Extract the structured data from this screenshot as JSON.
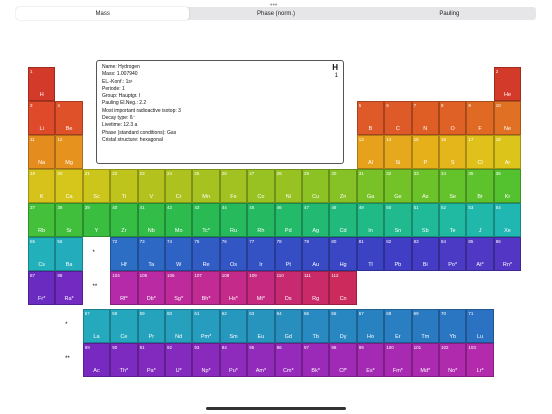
{
  "segmented_control": {
    "options": [
      "Mass",
      "Phase (norm.)",
      "Pauling"
    ],
    "selected": "Mass"
  },
  "info_panel": {
    "symbol": "H",
    "number": "1",
    "lines": [
      "Name: Hydrogen",
      "Mass: 1.007940",
      "EL.-Konf.: 1s¹",
      "Periode: 1",
      "Group: Hauptgr. I",
      "Pauling El.Neg.: 2.2",
      "Most important radioactive isotop: 3",
      "Decay type: ß⁻",
      "Livetime: 12.3 a",
      "Phase (standard conditions): Gas",
      "Cristal structure: hexagonal"
    ]
  },
  "elements": [
    {
      "n": 1,
      "s": "H",
      "p": 1,
      "g": 1,
      "color": "#d43a2a"
    },
    {
      "n": 2,
      "s": "He",
      "p": 1,
      "g": 18,
      "color": "#d43a2a"
    },
    {
      "n": 3,
      "s": "Li",
      "p": 2,
      "g": 1,
      "color": "#de4a2a"
    },
    {
      "n": 4,
      "s": "Be",
      "p": 2,
      "g": 2,
      "color": "#df5128"
    },
    {
      "n": 5,
      "s": "B",
      "p": 2,
      "g": 13,
      "color": "#de5a28"
    },
    {
      "n": 6,
      "s": "C",
      "p": 2,
      "g": 14,
      "color": "#de5a28"
    },
    {
      "n": 7,
      "s": "N",
      "p": 2,
      "g": 15,
      "color": "#df5e26"
    },
    {
      "n": 8,
      "s": "O",
      "p": 2,
      "g": 16,
      "color": "#df6125"
    },
    {
      "n": 9,
      "s": "F",
      "p": 2,
      "g": 17,
      "color": "#e06a24"
    },
    {
      "n": 10,
      "s": "Ne",
      "p": 2,
      "g": 18,
      "color": "#e07024"
    },
    {
      "n": 11,
      "s": "Na",
      "p": 3,
      "g": 1,
      "color": "#e58c1f"
    },
    {
      "n": 12,
      "s": "Mg",
      "p": 3,
      "g": 2,
      "color": "#e6921e"
    },
    {
      "n": 13,
      "s": "Al",
      "p": 3,
      "g": 13,
      "color": "#e6a21c"
    },
    {
      "n": 14,
      "s": "Si",
      "p": 3,
      "g": 14,
      "color": "#e6a81c"
    },
    {
      "n": 15,
      "s": "P",
      "p": 3,
      "g": 15,
      "color": "#e6b01b"
    },
    {
      "n": 16,
      "s": "S",
      "p": 3,
      "g": 16,
      "color": "#e5b61b"
    },
    {
      "n": 17,
      "s": "Cl",
      "p": 3,
      "g": 17,
      "color": "#e0c01a"
    },
    {
      "n": 18,
      "s": "Ar",
      "p": 3,
      "g": 18,
      "color": "#dcc41a"
    },
    {
      "n": 19,
      "s": "K",
      "p": 4,
      "g": 1,
      "color": "#d7c21b"
    },
    {
      "n": 20,
      "s": "Ca",
      "p": 4,
      "g": 2,
      "color": "#d6c61b"
    },
    {
      "n": 21,
      "s": "Sc",
      "p": 4,
      "g": 3,
      "color": "#ccc61c"
    },
    {
      "n": 22,
      "s": "Ti",
      "p": 4,
      "g": 4,
      "color": "#bfc41d"
    },
    {
      "n": 23,
      "s": "V",
      "p": 4,
      "g": 5,
      "color": "#b4c21e"
    },
    {
      "n": 24,
      "s": "Cr",
      "p": 4,
      "g": 6,
      "color": "#aec21f"
    },
    {
      "n": 25,
      "s": "Mn",
      "p": 4,
      "g": 7,
      "color": "#a6c220"
    },
    {
      "n": 26,
      "s": "Fe",
      "p": 4,
      "g": 8,
      "color": "#a2c221"
    },
    {
      "n": 27,
      "s": "Co",
      "p": 4,
      "g": 9,
      "color": "#98c222"
    },
    {
      "n": 28,
      "s": "Ni",
      "p": 4,
      "g": 10,
      "color": "#98c222"
    },
    {
      "n": 29,
      "s": "Cu",
      "p": 4,
      "g": 11,
      "color": "#8cc224"
    },
    {
      "n": 30,
      "s": "Zn",
      "p": 4,
      "g": 12,
      "color": "#86c225"
    },
    {
      "n": 31,
      "s": "Ga",
      "p": 4,
      "g": 13,
      "color": "#78c227"
    },
    {
      "n": 32,
      "s": "Ge",
      "p": 4,
      "g": 14,
      "color": "#72c228"
    },
    {
      "n": 33,
      "s": "As",
      "p": 4,
      "g": 15,
      "color": "#6cc229"
    },
    {
      "n": 34,
      "s": "Se",
      "p": 4,
      "g": 16,
      "color": "#64c22b"
    },
    {
      "n": 35,
      "s": "Br",
      "p": 4,
      "g": 17,
      "color": "#5ec22c"
    },
    {
      "n": 36,
      "s": "Kr",
      "p": 4,
      "g": 18,
      "color": "#54c22e"
    },
    {
      "n": 37,
      "s": "Rb",
      "p": 5,
      "g": 1,
      "color": "#44c03a"
    },
    {
      "n": 38,
      "s": "Sr",
      "p": 5,
      "g": 2,
      "color": "#40bf3c"
    },
    {
      "n": 39,
      "s": "Y",
      "p": 5,
      "g": 3,
      "color": "#3abe40"
    },
    {
      "n": 40,
      "s": "Zr",
      "p": 5,
      "g": 4,
      "color": "#36bd44"
    },
    {
      "n": 41,
      "s": "Nb",
      "p": 5,
      "g": 5,
      "color": "#32bc48"
    },
    {
      "n": 42,
      "s": "Mo",
      "p": 5,
      "g": 6,
      "color": "#2ebb4e"
    },
    {
      "n": 43,
      "s": "Tc*",
      "p": 5,
      "g": 7,
      "color": "#2aba54"
    },
    {
      "n": 44,
      "s": "Ru",
      "p": 5,
      "g": 8,
      "color": "#27ba5c"
    },
    {
      "n": 45,
      "s": "Rh",
      "p": 5,
      "g": 9,
      "color": "#25ba62"
    },
    {
      "n": 46,
      "s": "Pd",
      "p": 5,
      "g": 10,
      "color": "#23ba6a"
    },
    {
      "n": 47,
      "s": "Ag",
      "p": 5,
      "g": 11,
      "color": "#22ba72"
    },
    {
      "n": 48,
      "s": "Cd",
      "p": 5,
      "g": 12,
      "color": "#21ba7c"
    },
    {
      "n": 49,
      "s": "In",
      "p": 5,
      "g": 13,
      "color": "#20ba86"
    },
    {
      "n": 50,
      "s": "Sn",
      "p": 5,
      "g": 14,
      "color": "#20ba8e"
    },
    {
      "n": 51,
      "s": "Sb",
      "p": 5,
      "g": 15,
      "color": "#20ba98"
    },
    {
      "n": 52,
      "s": "Te",
      "p": 5,
      "g": 16,
      "color": "#20b9a2"
    },
    {
      "n": 53,
      "s": "J",
      "p": 5,
      "g": 17,
      "color": "#20b8aa"
    },
    {
      "n": 54,
      "s": "Xe",
      "p": 5,
      "g": 18,
      "color": "#20b6b2"
    },
    {
      "n": 55,
      "s": "Cs",
      "p": 6,
      "g": 1,
      "color": "#22b0ba"
    },
    {
      "n": 56,
      "s": "Ba",
      "p": 6,
      "g": 2,
      "color": "#22acbc"
    },
    {
      "n": 72,
      "s": "Hf",
      "p": 6,
      "g": 4,
      "color": "#2b6ec4"
    },
    {
      "n": 73,
      "s": "Ta",
      "p": 6,
      "g": 5,
      "color": "#2c68c4"
    },
    {
      "n": 74,
      "s": "W",
      "p": 6,
      "g": 6,
      "color": "#2e62c4"
    },
    {
      "n": 75,
      "s": "Re",
      "p": 6,
      "g": 7,
      "color": "#305cc4"
    },
    {
      "n": 76,
      "s": "Os",
      "p": 6,
      "g": 8,
      "color": "#3256c4"
    },
    {
      "n": 77,
      "s": "Ir",
      "p": 6,
      "g": 9,
      "color": "#3452c4"
    },
    {
      "n": 78,
      "s": "Pt",
      "p": 6,
      "g": 10,
      "color": "#364ec4"
    },
    {
      "n": 79,
      "s": "Au",
      "p": 6,
      "g": 11,
      "color": "#384ac4"
    },
    {
      "n": 80,
      "s": "Hg",
      "p": 6,
      "g": 12,
      "color": "#3a46c4"
    },
    {
      "n": 81,
      "s": "Tl",
      "p": 6,
      "g": 13,
      "color": "#3c42c4"
    },
    {
      "n": 82,
      "s": "Pb",
      "p": 6,
      "g": 14,
      "color": "#403ec4"
    },
    {
      "n": 83,
      "s": "Bi",
      "p": 6,
      "g": 15,
      "color": "#443cc4"
    },
    {
      "n": 84,
      "s": "Po*",
      "p": 6,
      "g": 16,
      "color": "#4a3ac4"
    },
    {
      "n": 85,
      "s": "At*",
      "p": 6,
      "g": 17,
      "color": "#4e38c4"
    },
    {
      "n": 86,
      "s": "Rn*",
      "p": 6,
      "g": 18,
      "color": "#5436c4"
    },
    {
      "n": 87,
      "s": "Fr*",
      "p": 7,
      "g": 1,
      "color": "#6a2cc0"
    },
    {
      "n": 88,
      "s": "Ra*",
      "p": 7,
      "g": 2,
      "color": "#722ac0"
    },
    {
      "n": 104,
      "s": "Rf*",
      "p": 7,
      "g": 4,
      "color": "#b42aa8"
    },
    {
      "n": 105,
      "s": "Db*",
      "p": 7,
      "g": 5,
      "color": "#ba2aa2"
    },
    {
      "n": 106,
      "s": "Sg*",
      "p": 7,
      "g": 6,
      "color": "#be2a9c"
    },
    {
      "n": 107,
      "s": "Bh*",
      "p": 7,
      "g": 7,
      "color": "#c22a94"
    },
    {
      "n": 108,
      "s": "Hs*",
      "p": 7,
      "g": 8,
      "color": "#c42a8a"
    },
    {
      "n": 109,
      "s": "Mt*",
      "p": 7,
      "g": 9,
      "color": "#c62a80"
    },
    {
      "n": 110,
      "s": "Ds",
      "p": 7,
      "g": 10,
      "color": "#c82a72"
    },
    {
      "n": 111,
      "s": "Rg",
      "p": 7,
      "g": 11,
      "color": "#ca2a68"
    },
    {
      "n": 112,
      "s": "Cn",
      "p": 7,
      "g": 12,
      "color": "#cc2a5c"
    },
    {
      "n": 57,
      "s": "La",
      "p": 9,
      "g": 3,
      "color": "#24aabc"
    },
    {
      "n": 58,
      "s": "Ce",
      "p": 9,
      "g": 4,
      "color": "#24a6bc"
    },
    {
      "n": 59,
      "s": "Pr",
      "p": 9,
      "g": 5,
      "color": "#25a2bc"
    },
    {
      "n": 60,
      "s": "Nd",
      "p": 9,
      "g": 6,
      "color": "#26a0bc"
    },
    {
      "n": 61,
      "s": "Pm*",
      "p": 9,
      "g": 7,
      "color": "#269cbe"
    },
    {
      "n": 62,
      "s": "Sm",
      "p": 9,
      "g": 8,
      "color": "#2698be"
    },
    {
      "n": 63,
      "s": "Eu",
      "p": 9,
      "g": 9,
      "color": "#2794be"
    },
    {
      "n": 64,
      "s": "Gd",
      "p": 9,
      "g": 10,
      "color": "#288ebe"
    },
    {
      "n": 65,
      "s": "Tb",
      "p": 9,
      "g": 11,
      "color": "#288ac0"
    },
    {
      "n": 66,
      "s": "Dy",
      "p": 9,
      "g": 12,
      "color": "#2886c0"
    },
    {
      "n": 67,
      "s": "Ho",
      "p": 9,
      "g": 13,
      "color": "#2982c0"
    },
    {
      "n": 68,
      "s": "Er",
      "p": 9,
      "g": 14,
      "color": "#2a7ec2"
    },
    {
      "n": 69,
      "s": "Tm",
      "p": 9,
      "g": 15,
      "color": "#2a7ac2"
    },
    {
      "n": 70,
      "s": "Yb",
      "p": 9,
      "g": 16,
      "color": "#2b76c2"
    },
    {
      "n": 71,
      "s": "Lu",
      "p": 9,
      "g": 17,
      "color": "#2b72c2"
    },
    {
      "n": 89,
      "s": "Ac",
      "p": 10,
      "g": 3,
      "color": "#782ac0"
    },
    {
      "n": 90,
      "s": "Th*",
      "p": 10,
      "g": 4,
      "color": "#7c2ac0"
    },
    {
      "n": 91,
      "s": "Pa*",
      "p": 10,
      "g": 5,
      "color": "#822abe"
    },
    {
      "n": 92,
      "s": "U*",
      "p": 10,
      "g": 6,
      "color": "#842abe"
    },
    {
      "n": 93,
      "s": "Np*",
      "p": 10,
      "g": 7,
      "color": "#8a2abc"
    },
    {
      "n": 94,
      "s": "Pu*",
      "p": 10,
      "g": 8,
      "color": "#8e2abc"
    },
    {
      "n": 95,
      "s": "Am*",
      "p": 10,
      "g": 9,
      "color": "#922aba"
    },
    {
      "n": 96,
      "s": "Cm*",
      "p": 10,
      "g": 10,
      "color": "#962aba"
    },
    {
      "n": 97,
      "s": "Bk*",
      "p": 10,
      "g": 11,
      "color": "#9c2ab8"
    },
    {
      "n": 98,
      "s": "Cf*",
      "p": 10,
      "g": 12,
      "color": "#a02ab6"
    },
    {
      "n": 99,
      "s": "Es*",
      "p": 10,
      "g": 13,
      "color": "#a42ab4"
    },
    {
      "n": 100,
      "s": "Fm*",
      "p": 10,
      "g": 14,
      "color": "#a82ab2"
    },
    {
      "n": 101,
      "s": "Md*",
      "p": 10,
      "g": 15,
      "color": "#ac2ab0"
    },
    {
      "n": 102,
      "s": "No*",
      "p": 10,
      "g": 16,
      "color": "#b02aae"
    },
    {
      "n": 103,
      "s": "Lr*",
      "p": 10,
      "g": 17,
      "color": "#b42aac"
    }
  ],
  "markers": [
    {
      "text": "*",
      "p": 6,
      "g": 3
    },
    {
      "text": "**",
      "p": 7,
      "g": 3
    },
    {
      "text": "*",
      "p": 9,
      "g": 2
    },
    {
      "text": "**",
      "p": 10,
      "g": 2
    }
  ]
}
